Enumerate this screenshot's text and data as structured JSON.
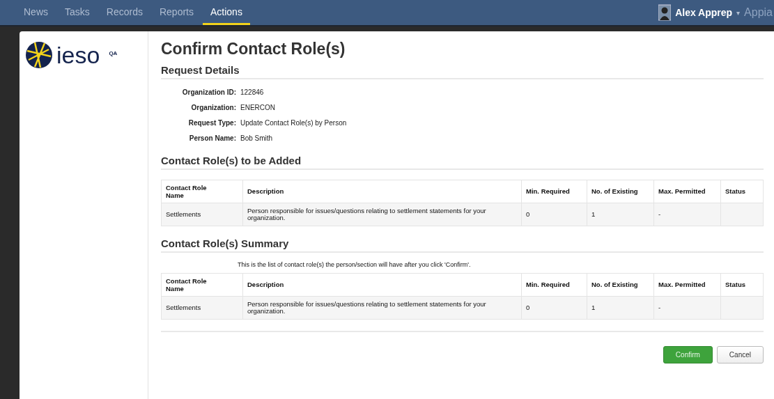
{
  "nav": {
    "tabs": [
      {
        "label": "News",
        "selected": false
      },
      {
        "label": "Tasks",
        "selected": false
      },
      {
        "label": "Records",
        "selected": false
      },
      {
        "label": "Reports",
        "selected": false
      },
      {
        "label": "Actions",
        "selected": true
      }
    ],
    "user": "Alex Apprep",
    "caret": "▾",
    "brand": "Appia"
  },
  "logo": {
    "text": "ieso",
    "badge": "QA"
  },
  "title": "Confirm Contact Role(s)",
  "request_details": {
    "heading": "Request Details",
    "fields": [
      {
        "label": "Organization ID:",
        "value": "122846"
      },
      {
        "label": "Organization:",
        "value": "ENERCON"
      },
      {
        "label": "Request Type:",
        "value": "Update Contact Role(s) by Person"
      },
      {
        "label": "Person Name:",
        "value": "Bob Smith"
      }
    ]
  },
  "sections": [
    {
      "heading": "Contact Role(s) to be Added",
      "columns": [
        "Contact Role Name",
        "Description",
        "Min. Required",
        "No. of Existing",
        "Max. Permitted",
        "Status"
      ],
      "rows": [
        [
          "Settlements",
          "Person responsible for issues/questions relating to settlement statements for your organization.",
          "0",
          "1",
          "-",
          ""
        ]
      ]
    },
    {
      "heading": "Contact Role(s) Summary",
      "note": "This is the list of contact role(s) the person/section will have after you click 'Confirm'.",
      "columns": [
        "Contact Role Name",
        "Description",
        "Min. Required",
        "No. of Existing",
        "Max. Permitted",
        "Status"
      ],
      "rows": [
        [
          "Settlements",
          "Person responsible for issues/questions relating to settlement statements for your organization.",
          "0",
          "1",
          "-",
          ""
        ]
      ]
    }
  ],
  "buttons": [
    {
      "label": "Confirm",
      "kind": "primary"
    },
    {
      "label": "Cancel",
      "kind": "secondary"
    }
  ]
}
